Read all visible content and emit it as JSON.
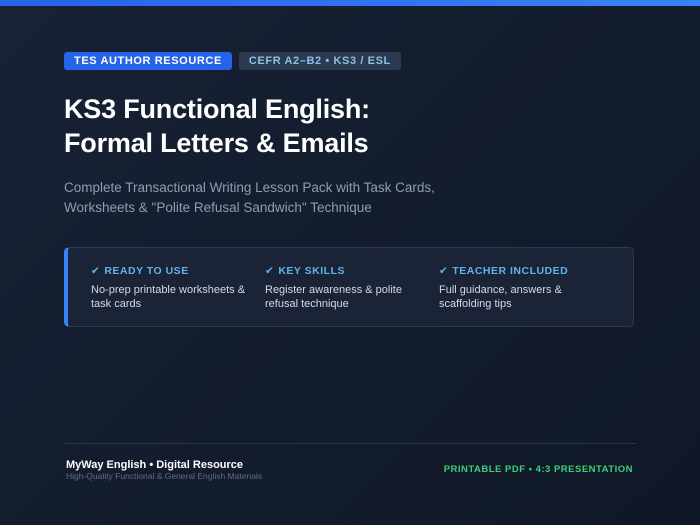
{
  "badges": {
    "primary": "TES AUTHOR RESOURCE",
    "secondary": "CEFR A2–B2 • KS3 / ESL"
  },
  "title": {
    "line1": "KS3 Functional English:",
    "line2": "Formal Letters & Emails"
  },
  "subtitle": {
    "line1": "Complete Transactional Writing Lesson Pack with Task Cards,",
    "line2": "Worksheets & \"Polite Refusal Sandwich\" Technique"
  },
  "features": [
    {
      "check": "✔",
      "title": "READY TO USE",
      "text": "No-prep printable worksheets & task cards"
    },
    {
      "check": "✔",
      "title": "KEY SKILLS",
      "text": "Register awareness & polite refusal technique"
    },
    {
      "check": "✔",
      "title": "TEACHER INCLUDED",
      "text": "Full guidance, answers & scaffolding tips"
    }
  ],
  "footer": {
    "brand": "MyWay English • Digital Resource",
    "tagline": "High-Quality Functional & General English Materials",
    "format": "PRINTABLE PDF • 4:3 PRESENTATION"
  },
  "colors": {
    "accent_blue": "#2563eb",
    "feature_heading": "#60b3ec",
    "footer_green": "#3ecf78",
    "background": "#141d2d"
  },
  "icons": {
    "feature_check": "check-icon"
  }
}
